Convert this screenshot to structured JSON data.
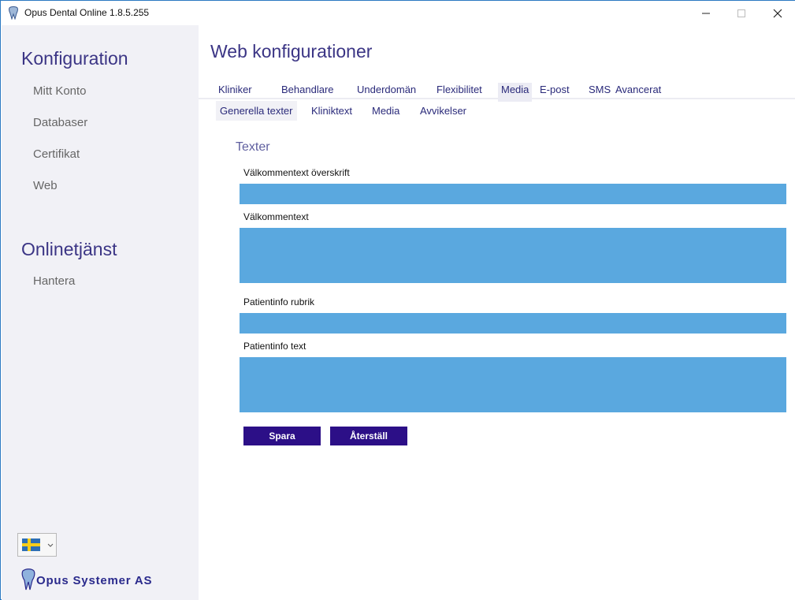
{
  "window": {
    "title": "Opus Dental Online 1.8.5.255",
    "icons": {
      "app": "tooth-icon",
      "minimize": "minimize-icon",
      "maximize": "maximize-icon",
      "close": "close-icon"
    }
  },
  "sidebar": {
    "sections": [
      {
        "title": "Konfiguration",
        "items": [
          "Mitt Konto",
          "Databaser",
          "Certifikat",
          "Web"
        ]
      },
      {
        "title": "Onlinetjänst",
        "items": [
          "Hantera"
        ]
      }
    ],
    "language": {
      "selected": "Svenska",
      "icon": "swedish-flag-icon"
    },
    "logo_text": "Opus Systemer AS"
  },
  "main": {
    "title": "Web konfigurationer",
    "tabs": [
      "Kliniker",
      "Behandlare",
      "Underdomän",
      "Flexibilitet",
      "Media",
      "E-post",
      "SMS",
      "Avancerat"
    ],
    "active_tab": "Media",
    "subtabs": [
      "Generella texter",
      "Kliniktext",
      "Media",
      "Avvikelser"
    ],
    "active_subtab": "Generella texter",
    "group_title": "Texter",
    "fields": [
      {
        "label": "Välkommentext överskrift",
        "value": ""
      },
      {
        "label": "Välkommentext",
        "value": ""
      },
      {
        "label": "Patientinfo rubrik",
        "value": ""
      },
      {
        "label": "Patientinfo text",
        "value": ""
      }
    ],
    "buttons": {
      "save": "Spara",
      "reset": "Återställ"
    }
  },
  "colors": {
    "accent": "#3b3585",
    "field": "#5aa8df",
    "button": "#2c0f87",
    "sidebar_bg": "#f1f1f6"
  }
}
